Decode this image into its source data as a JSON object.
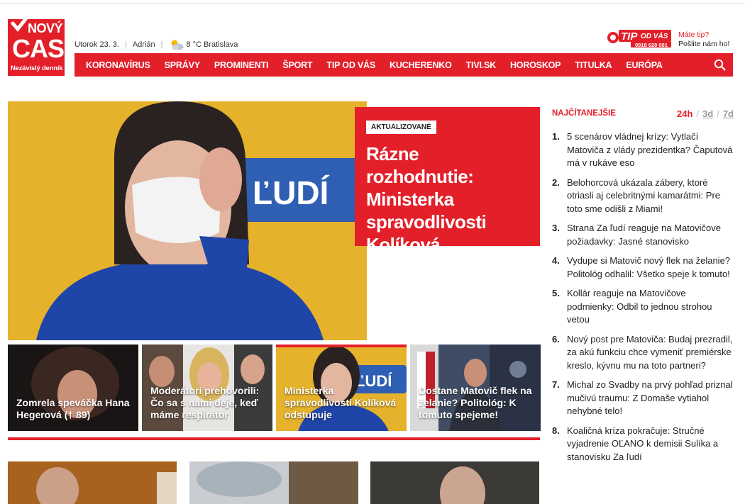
{
  "logo": {
    "top": "NOVÝ",
    "main": "CAS",
    "tagline": "Nezávislý denník"
  },
  "meta": {
    "date": "Utorok 23. 3.",
    "nameday": "Adrián",
    "temp": "8 °C",
    "city": "Bratislava"
  },
  "nav": {
    "items": [
      "KORONAVÍRUS",
      "SPRÁVY",
      "PROMINENTI",
      "ŠPORT",
      "TIP OD VÁS",
      "KUCHERENKO",
      "TIVI.SK",
      "HOROSKOP",
      "TITULKA",
      "EURÓPA"
    ]
  },
  "tip": {
    "brand": "TIP",
    "brand2": "OD VÁS",
    "phone": "0918 620 001",
    "question": "Máte tip?",
    "cta": "Pošlite nám ho!"
  },
  "hero": {
    "badge": "AKTUALIZOVANÉ",
    "title": "Rázne rozhodnutie: Ministerka spravodlivosti Kolíková odstupuje!",
    "sign": "ĽUDÍ"
  },
  "cards": [
    {
      "title": "Zomrela speváčka Hana Hegerová († 89)"
    },
    {
      "title": "Moderátori prehovorili: Čo sa s nami deje, keď máme respirátor"
    },
    {
      "title": "Ministerka spravodlivosti Kolíková odstupuje",
      "sign": "ĽUDÍ"
    },
    {
      "title": "Dostane Matovič flek na želanie? Politológ: K tomuto spejeme!"
    }
  ],
  "sidebar": {
    "title": "NAJČÍTANEJŠIE",
    "tabs": [
      "24h",
      "3d",
      "7d"
    ],
    "items": [
      {
        "n": "1.",
        "text": "5 scenárov vládnej krízy: Vytlačí Matoviča z vlády prezidentka? Čaputová má v rukáve eso"
      },
      {
        "n": "2.",
        "text": "Belohorcová ukázala zábery, ktoré otriasli aj celebritnými kamarátmi: Pre toto sme odišli z Miami!"
      },
      {
        "n": "3.",
        "text": "Strana Za ľudí reaguje na Matovičove požiadavky: Jasné stanovisko"
      },
      {
        "n": "4.",
        "text": "Vydupe si Matovič nový flek na želanie? Politológ odhalil: Všetko speje k tomuto!"
      },
      {
        "n": "5.",
        "text": "Kollár reaguje na Matovičove podmienky: Odbil to jednou strohou vetou"
      },
      {
        "n": "6.",
        "text": "Nový post pre Matoviča: Budaj prezradil, za akú funkciu chce vymeniť premiérske kreslo, kývnu mu na toto partneri?"
      },
      {
        "n": "7.",
        "text": "Michal zo Svadby na prvý pohľad priznal mučivú traumu: Z Domaše vytiahol nehybné telo!"
      },
      {
        "n": "8.",
        "text": "Koaličná kríza pokračuje: Stručné vyjadrenie OĽANO k demisii Sulíka a stanovisku Za ľudí"
      }
    ]
  },
  "colors": {
    "brand": "#e3202a"
  }
}
